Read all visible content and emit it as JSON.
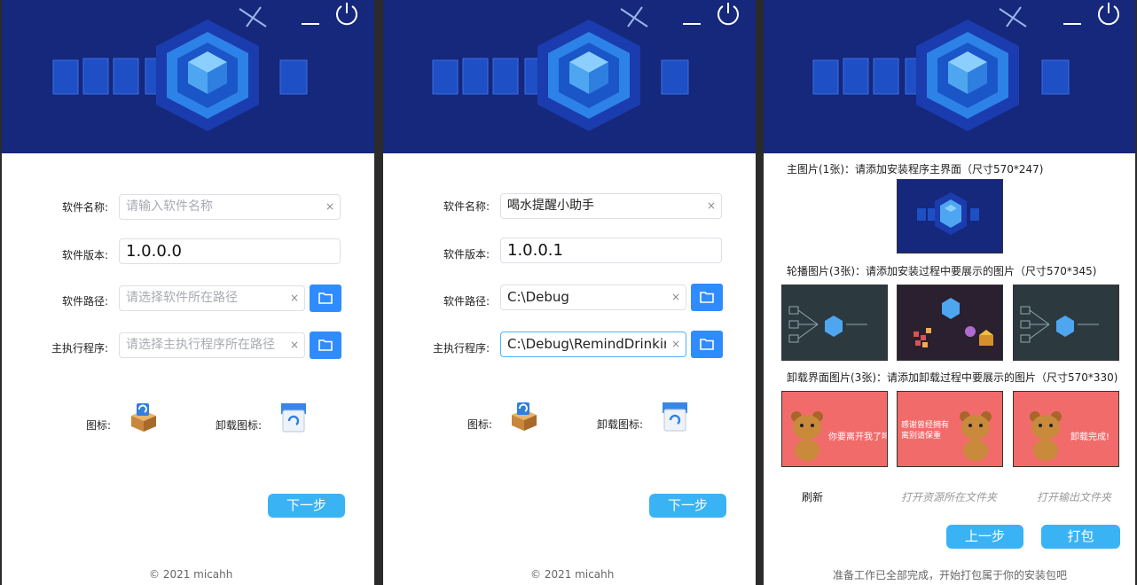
{
  "screen1": {
    "labels": {
      "name": "软件名称:",
      "version": "软件版本:",
      "path": "软件路径:",
      "main_exe": "主执行程序:"
    },
    "fields": {
      "name": {
        "value": "",
        "placeholder": "请输入软件名称"
      },
      "version": {
        "value": "1.0.0.0"
      },
      "path": {
        "value": "",
        "placeholder": "请选择软件所在路径"
      },
      "main_exe": {
        "value": "",
        "placeholder": "请选择主执行程序所在路径"
      }
    },
    "clear_glyph": "×",
    "icon_label": "图标:",
    "uninstall_icon_label": "卸载图标:",
    "next_button": "下一步",
    "footer": "© 2021 micahh"
  },
  "screen2": {
    "labels": {
      "name": "软件名称:",
      "version": "软件版本:",
      "path": "软件路径:",
      "main_exe": "主执行程序:"
    },
    "fields": {
      "name": {
        "value": "喝水提醒小助手"
      },
      "version": {
        "value": "1.0.0.1"
      },
      "path": {
        "value": "C:\\Debug"
      },
      "main_exe": {
        "value": "C:\\Debug\\RemindDrinking.e"
      }
    },
    "clear_glyph": "×",
    "icon_label": "图标:",
    "uninstall_icon_label": "卸载图标:",
    "next_button": "下一步",
    "footer": "© 2021 micahh"
  },
  "screen3": {
    "main_image_title": "主图片(1张)：请添加安装程序主界面（尺寸570*247)",
    "carousel_title": "轮播图片(3张)：请添加安装过程中要展示的图片（尺寸570*345)",
    "uninstall_title": "卸载界面图片(3张)：请添加卸载过程中要展示的图片（尺寸570*330)",
    "uninstall_captions": [
      "你要离开我了吗?",
      "感谢曾经拥有\n离别请保重",
      "卸载完成!"
    ],
    "refresh": "刷新",
    "open_resource_folder": "打开资源所在文件夹",
    "open_output_folder": "打开输出文件夹",
    "prev_button": "上一步",
    "pack_button": "打包",
    "status": "准备工作已全部完成，开始打包属于你的安装包吧"
  },
  "colors": {
    "banner": "#15287c",
    "accent": "#3ab3f5",
    "folder_button": "#2f8cff",
    "uninstall_bg": "#f26b6b"
  },
  "icons": [
    "minimize-icon",
    "power-icon",
    "folder-icon",
    "install-box-icon",
    "uninstall-icon",
    "clear-icon"
  ]
}
